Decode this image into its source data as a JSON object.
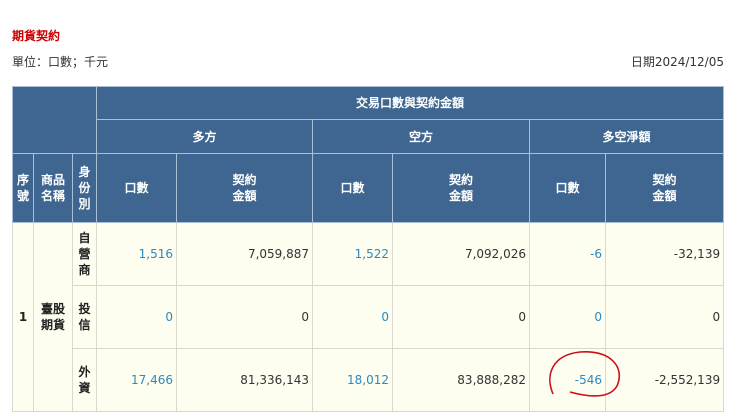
{
  "title": "期貨契約",
  "unit": "單位：口數；千元",
  "date": "日期2024/12/05",
  "headers": {
    "group": "交易口數與契約金額",
    "long": "多方",
    "short": "空方",
    "net": "多空淨額",
    "seq": "序號",
    "product": "商品名稱",
    "identity": "身份別",
    "volume": "口數",
    "amount": "契約金額"
  },
  "rows": [
    {
      "seq": "1",
      "product": "臺股期貨",
      "identity": "自營商",
      "long_vol": "1,516",
      "long_amt": "7,059,887",
      "short_vol": "1,522",
      "short_amt": "7,092,026",
      "net_vol": "-6",
      "net_amt": "-32,139"
    },
    {
      "identity": "投信",
      "long_vol": "0",
      "long_amt": "0",
      "short_vol": "0",
      "short_amt": "0",
      "net_vol": "0",
      "net_amt": "0"
    },
    {
      "identity": "外資",
      "long_vol": "17,466",
      "long_amt": "81,336,143",
      "short_vol": "18,012",
      "short_amt": "83,888,282",
      "net_vol": "-546",
      "net_amt": "-2,552,139"
    }
  ],
  "annotation_color": "#c8101a"
}
